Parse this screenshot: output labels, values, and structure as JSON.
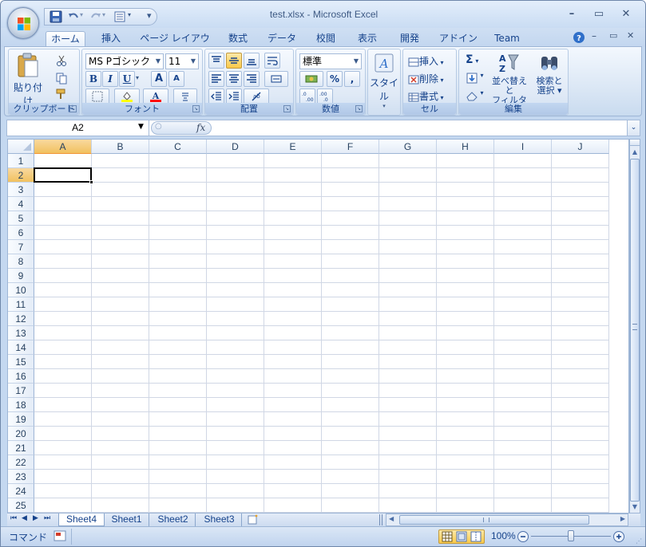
{
  "window": {
    "title": "test.xlsx - Microsoft Excel"
  },
  "qat": {
    "customize": "▾"
  },
  "window_controls": {
    "minimize": "–",
    "maximize": "▭",
    "close": "✕"
  },
  "tabs": [
    {
      "label": "ホーム"
    },
    {
      "label": "挿入"
    },
    {
      "label": "ページ レイアウト"
    },
    {
      "label": "数式"
    },
    {
      "label": "データ"
    },
    {
      "label": "校閲"
    },
    {
      "label": "表示"
    },
    {
      "label": "開発"
    },
    {
      "label": "アドイン"
    },
    {
      "label": "Team"
    }
  ],
  "ribbon": {
    "clipboard": {
      "paste": "貼り付け",
      "label": "クリップボード"
    },
    "font": {
      "name": "MS Pゴシック",
      "size": "11",
      "bold": "B",
      "italic": "I",
      "underline": "U",
      "grow": "A",
      "shrink": "A",
      "label": "フォント"
    },
    "alignment": {
      "label": "配置"
    },
    "number": {
      "format": "標準",
      "percent": "%",
      "comma": ",",
      "label": "数値"
    },
    "styles": {
      "styles": "スタイル"
    },
    "cells": {
      "insert": "挿入",
      "delete": "削除",
      "format": "書式",
      "label": "セル"
    },
    "editing": {
      "sum": "Σ",
      "sort": "並べ替えと",
      "sort2": "フィルタ",
      "find": "検索と",
      "find2": "選択",
      "label": "編集"
    }
  },
  "formula_bar": {
    "name_box": "A2",
    "fx": "fx",
    "content": ""
  },
  "grid": {
    "columns": [
      "A",
      "B",
      "C",
      "D",
      "E",
      "F",
      "G",
      "H",
      "I",
      "J"
    ],
    "rows": [
      "1",
      "2",
      "3",
      "4",
      "5",
      "6",
      "7",
      "8",
      "9",
      "10",
      "11",
      "12",
      "13",
      "14",
      "15",
      "16",
      "17",
      "18",
      "19",
      "20",
      "21",
      "22",
      "23",
      "24",
      "25"
    ],
    "active_cell": "A2"
  },
  "sheets": [
    {
      "label": "Sheet4",
      "active": true
    },
    {
      "label": "Sheet1"
    },
    {
      "label": "Sheet2"
    },
    {
      "label": "Sheet3"
    }
  ],
  "status": {
    "mode": "コマンド",
    "zoom": "100%",
    "zoom_level_percent": 100
  }
}
